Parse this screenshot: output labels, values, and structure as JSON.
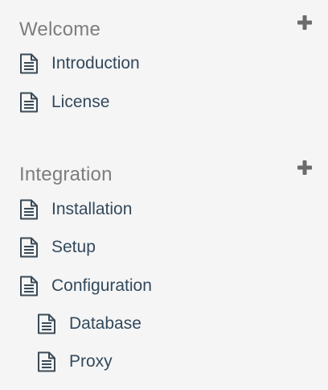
{
  "sections": [
    {
      "title": "Welcome",
      "add_icon": "plus-icon",
      "items": [
        {
          "label": "Introduction",
          "icon": "document-icon"
        },
        {
          "label": "License",
          "icon": "document-icon"
        }
      ]
    },
    {
      "title": "Integration",
      "add_icon": "plus-icon",
      "items": [
        {
          "label": "Installation",
          "icon": "document-icon"
        },
        {
          "label": "Setup",
          "icon": "document-icon"
        },
        {
          "label": "Configuration",
          "icon": "document-icon"
        },
        {
          "label": "Database",
          "icon": "document-icon",
          "nested": true
        },
        {
          "label": "Proxy",
          "icon": "document-icon",
          "nested": true
        }
      ]
    }
  ],
  "colors": {
    "background": "#f5f5f5",
    "section_title": "#7d7d7d",
    "item_text": "#33495c",
    "icon_stroke": "#3a4a57",
    "add_icon": "#6b6b6b"
  }
}
